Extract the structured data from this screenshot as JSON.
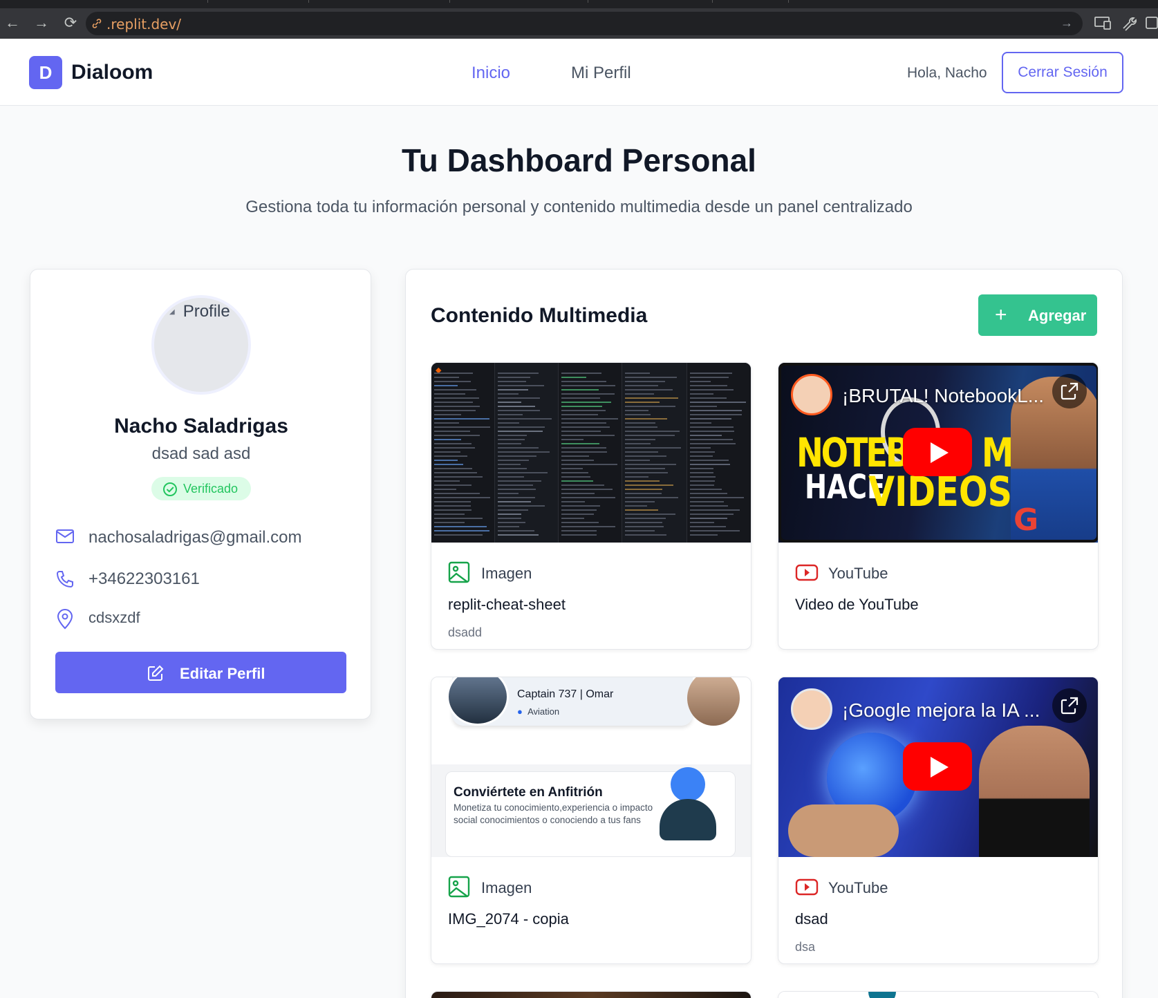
{
  "browser": {
    "url": ".replit.dev/"
  },
  "header": {
    "logo_letter": "D",
    "brand": "Dialoom",
    "nav": [
      {
        "label": "Inicio",
        "active": true
      },
      {
        "label": "Mi Perfil",
        "active": false
      }
    ],
    "greeting": "Hola, Nacho",
    "logout_label": "Cerrar Sesión"
  },
  "hero": {
    "title": "Tu Dashboard Personal",
    "subtitle": "Gestiona toda tu información personal y contenido multimedia desde un panel centralizado"
  },
  "profile": {
    "avatar_alt": "Profile",
    "name": "Nacho Saladrigas",
    "bio": "dsad sad asd",
    "verified_label": "Verificado",
    "email": "nachosaladrigas@gmail.com",
    "phone": "+34622303161",
    "location": "cdsxzdf",
    "edit_label": "Editar Perfil"
  },
  "multimedia": {
    "title": "Contenido Multimedia",
    "add_label": "Agregar",
    "items": [
      {
        "type": "Imagen",
        "title": "replit-cheat-sheet",
        "description": "dsadd"
      },
      {
        "type": "YouTube",
        "title": "Video de YouTube",
        "description": "",
        "video_title": "¡BRUTAL! NotebookL...",
        "thumb_text_1": "NOTEBO",
        "thumb_text_1b": "M",
        "thumb_text_2": "HACE",
        "thumb_text_3": "VIDEOS"
      },
      {
        "type": "Imagen",
        "title": "IMG_2074 - copia",
        "description": "",
        "img_text_1": "Captain 737 | Omar",
        "img_text_2": "Aviation",
        "img_text_3": "Conviértete en Anfitrión",
        "img_text_4": "Monetiza tu conocimiento,experiencia o impacto social conocimientos o conociendo a tus fans"
      },
      {
        "type": "YouTube",
        "title": "dsad",
        "description": "dsa",
        "video_title": "¡Google mejora la IA ..."
      }
    ]
  },
  "colors": {
    "accent": "#6366f1",
    "success": "#34c38f",
    "youtube_red": "#ff0000",
    "image_green": "#16a34a"
  }
}
